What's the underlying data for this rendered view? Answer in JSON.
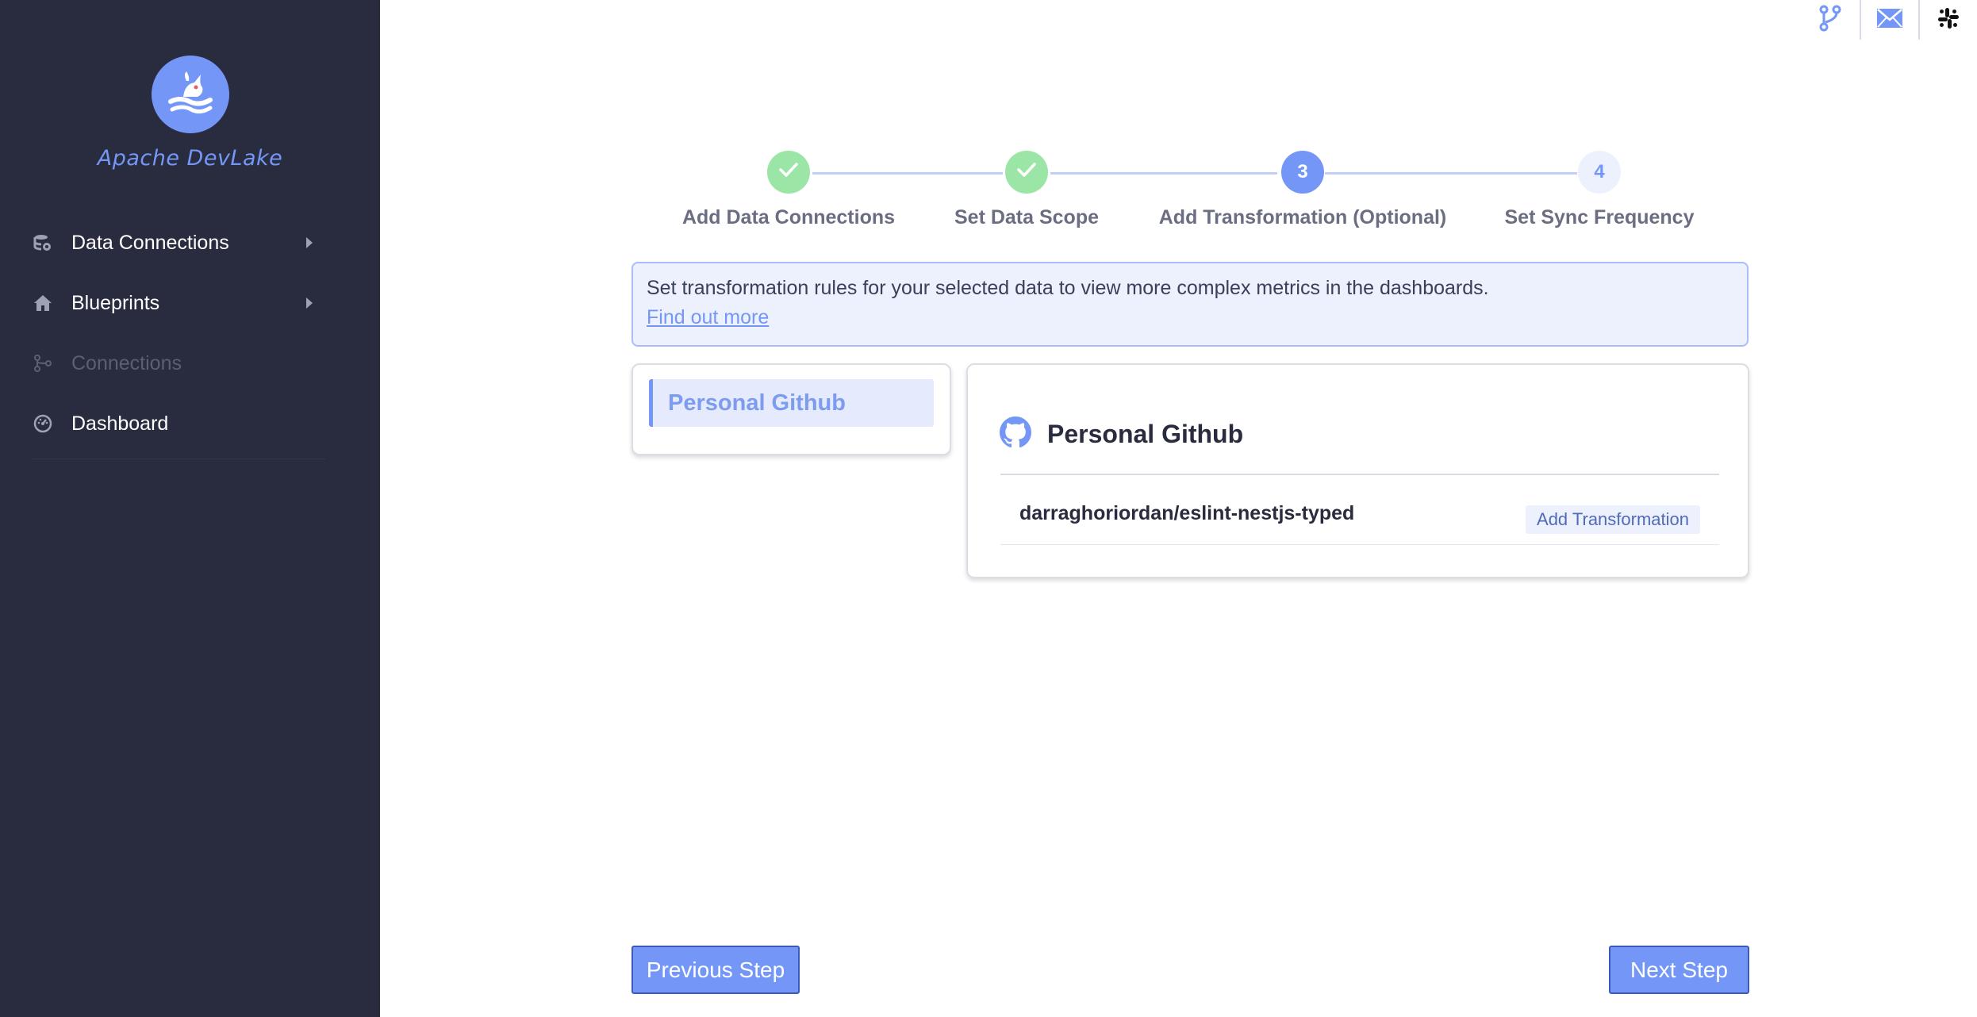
{
  "app": {
    "logo_text": "Apache DevLake",
    "brand_color": "#7497f7",
    "sidebar_bg": "#292b3f"
  },
  "sidebar": {
    "items": [
      {
        "label": "Data Connections",
        "icon": "database-icon",
        "has_submenu": true,
        "enabled": true
      },
      {
        "label": "Blueprints",
        "icon": "home-icon",
        "has_submenu": true,
        "enabled": true
      },
      {
        "label": "Connections",
        "icon": "git-branch-icon",
        "has_submenu": false,
        "enabled": false
      },
      {
        "label": "Dashboard",
        "icon": "dashboard-icon",
        "has_submenu": false,
        "enabled": true
      }
    ]
  },
  "top_icons": [
    "git-branch-icon",
    "mail-icon",
    "slack-icon"
  ],
  "stepper": {
    "steps": [
      {
        "number": "1",
        "label": "Add Data Connections",
        "status": "done"
      },
      {
        "number": "2",
        "label": "Set Data Scope",
        "status": "done"
      },
      {
        "number": "3",
        "label": "Add Transformation (Optional)",
        "status": "active"
      },
      {
        "number": "4",
        "label": "Set Sync Frequency",
        "status": "pending"
      }
    ]
  },
  "callout": {
    "text": "Set transformation rules for your selected data to view more complex metrics in the dashboards.",
    "link": "Find out more"
  },
  "connection_list": {
    "items": [
      {
        "label": "Personal Github",
        "selected": true
      }
    ]
  },
  "detail": {
    "title": "Personal Github",
    "icon": "github-icon",
    "rows": [
      {
        "repo": "darraghoriordan/eslint-nestjs-typed",
        "action_label": "Add Transformation"
      }
    ]
  },
  "footer": {
    "previous_label": "Previous Step",
    "next_label": "Next Step"
  }
}
